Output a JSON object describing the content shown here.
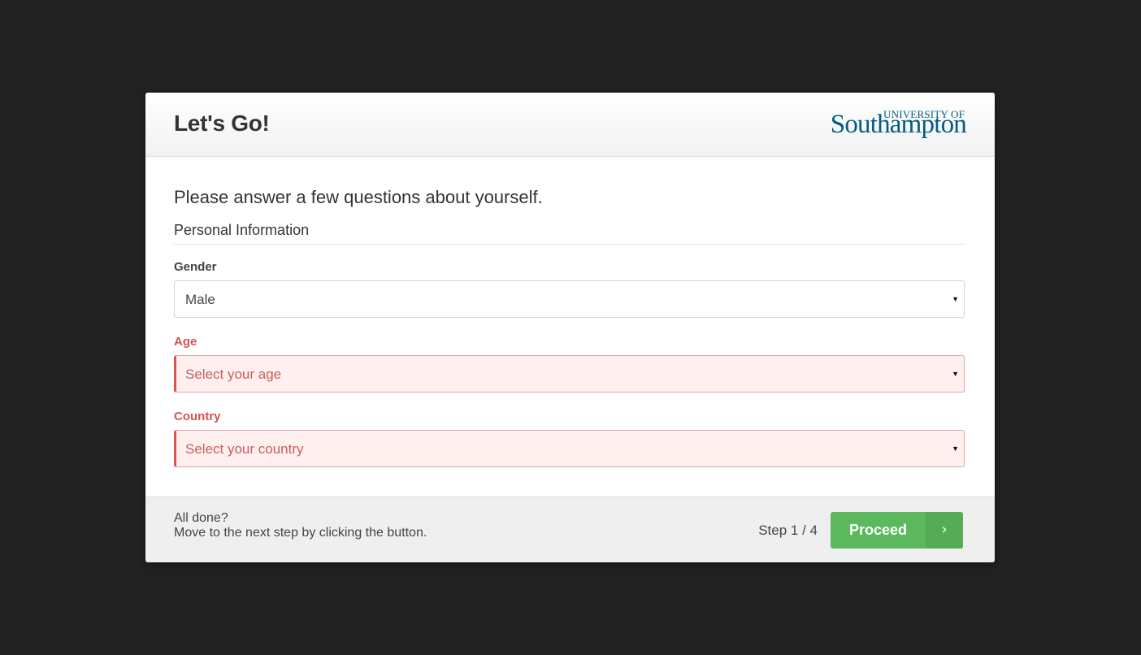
{
  "dialog": {
    "title": "Let's Go!",
    "logo": {
      "top": "UNIVERSITY OF",
      "main": "Southampton"
    }
  },
  "body": {
    "lead": "Please answer a few questions about yourself.",
    "section_title": "Personal Information",
    "fields": {
      "gender": {
        "label": "Gender",
        "value": "Male"
      },
      "age": {
        "label": "Age",
        "placeholder": "Select your age"
      },
      "country": {
        "label": "Country",
        "placeholder": "Select your country"
      }
    }
  },
  "footer": {
    "line1": "All done?",
    "line2": "Move to the next step by clicking the button.",
    "step": "Step 1 / 4",
    "proceed_label": "Proceed"
  },
  "icons": {
    "caret": "caret-down-icon",
    "arrow": "chevron-right-icon"
  },
  "colors": {
    "error": "#d9534f",
    "error_bg": "#ffefef",
    "success": "#5cb85c",
    "brand": "#005c84"
  }
}
